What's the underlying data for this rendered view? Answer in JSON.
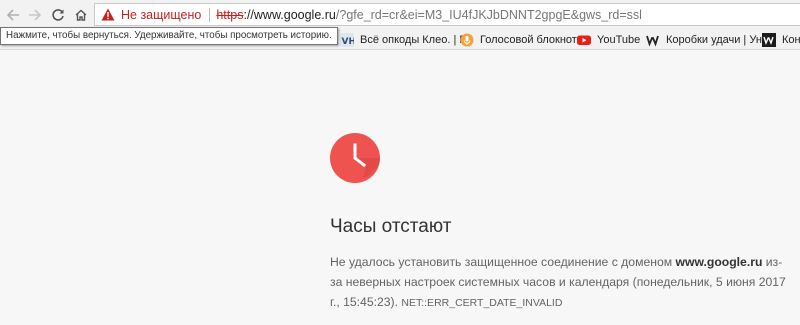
{
  "toolbar": {
    "security_label": "Не защищено",
    "url_scheme": "https",
    "url_host": "://www.google.ru",
    "url_rest": "/?gfe_rd=cr&ei=M3_IU4fJKJbDNNT2gpgE&gws_rd=ssl"
  },
  "tooltip": "Нажмите, чтобы вернуться. Удерживайте, чтобы просмотреть историю.",
  "bookmarks": [
    {
      "label": "Всё опкоды Клео. | E",
      "icon": "vh-icon"
    },
    {
      "label": "Голосовой блокнот",
      "icon": "microphone-icon"
    },
    {
      "label": "YouTube",
      "icon": "youtube-icon"
    },
    {
      "label": "Коробки удачи | Уни",
      "icon": "w-icon"
    },
    {
      "label": "Конк",
      "icon": "w-box-icon"
    }
  ],
  "error": {
    "title": "Часы отстают",
    "text_before": "Не удалось установить защищенное соединение с доменом ",
    "domain": "www.google.ru",
    "text_after": " из-за неверных настроек системных часов и календаря (понедельник, 5 июня 2017 г., 15:45:23). ",
    "code": "NET::ERR_CERT_DATE_INVALID"
  },
  "colors": {
    "accent_red": "#ef5350",
    "warning_red": "#c5221f"
  }
}
